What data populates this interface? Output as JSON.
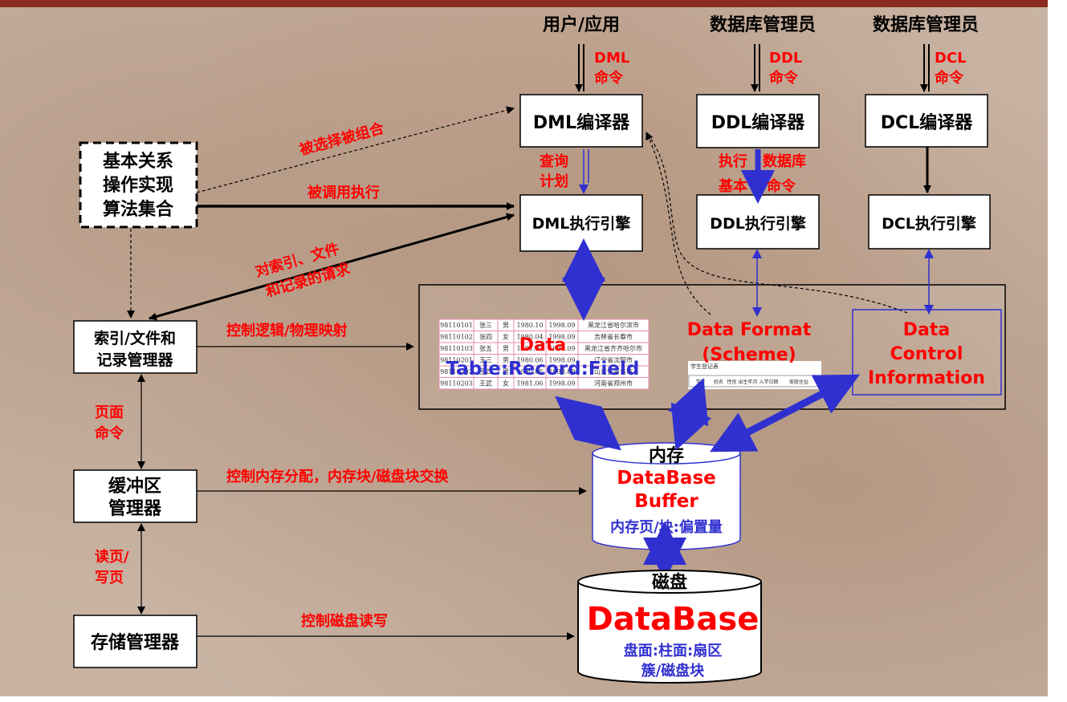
{
  "top": {
    "user_app": "用户/应用",
    "dba1": "数据库管理员",
    "dba2": "数据库管理员"
  },
  "commands": {
    "dml": [
      "DML",
      "命令"
    ],
    "ddl": [
      "DDL",
      "命令"
    ],
    "dcl": [
      "DCL",
      "命令"
    ]
  },
  "boxes": {
    "dml_compiler": "DML编译器",
    "ddl_compiler": "DDL编译器",
    "dcl_compiler": "DCL编译器",
    "dml_engine": "DML执行引擎",
    "ddl_engine": "DDL执行引擎",
    "dcl_engine": "DCL执行引擎",
    "algorithms": [
      "基本关系",
      "操作实现",
      "算法集合"
    ],
    "index_mgr": [
      "索引/文件和",
      "记录管理器"
    ],
    "buffer_mgr": [
      "缓冲区",
      "管理器"
    ],
    "storage_mgr": "存储管理器"
  },
  "labels": {
    "query_plan": [
      "查询",
      "计划"
    ],
    "exec_ddl": [
      "执行",
      "基本",
      "数据库",
      "命令"
    ],
    "selected": "被选择被组合",
    "called": "被调用执行",
    "requests": [
      "对索引、文件",
      "和记录的请求"
    ],
    "mapping": "控制逻辑/物理映射",
    "page_cmd": [
      "页面",
      "命令"
    ],
    "alloc": "控制内存分配，内存块/磁盘块交换",
    "rw_page": [
      "读页/",
      "写页"
    ],
    "disk_rw": "控制磁盘读写"
  },
  "data_area": {
    "data": "Data",
    "trf": "Table:Record:Field",
    "format": [
      "Data Format",
      "(Scheme)"
    ],
    "control": [
      "Data",
      "Control",
      "Information"
    ],
    "table_rows": [
      [
        "98110101",
        "张三",
        "男",
        "1980.10",
        "1998.09",
        "黑龙江省哈尔滨市"
      ],
      [
        "98110102",
        "张四",
        "女",
        "1980.04",
        "1998.09",
        "吉林省长春市"
      ],
      [
        "98110103",
        "张五",
        "男",
        "1981.02",
        "1998.09",
        "黑龙江省齐齐哈尔市"
      ],
      [
        "98110201",
        "王三",
        "男",
        "1980.06",
        "1998.09",
        "辽宁省沈阳市"
      ],
      [
        "98110202",
        "王四",
        "男",
        "1980.05",
        "1998.09",
        "山东省青岛市"
      ],
      [
        "98110203",
        "王武",
        "女",
        "1981.06",
        "1998.09",
        "河南省郑州市"
      ]
    ],
    "schema_title": "学生登记表",
    "schema_cols": [
      "学号",
      "姓名",
      "性别",
      "出生年月",
      "入学日期",
      "家庭住址"
    ]
  },
  "memory": {
    "title": "内存",
    "name": [
      "DataBase",
      "Buffer"
    ],
    "unit": "内存页/块:偏置量"
  },
  "disk": {
    "title": "磁盘",
    "name": "DataBase",
    "unit": [
      "盘面:柱面:扇区",
      "簇/磁盘块"
    ]
  },
  "colors": {
    "red": "#ff0000",
    "blue": "#3030d0",
    "topbar": "#8b2a1e"
  }
}
